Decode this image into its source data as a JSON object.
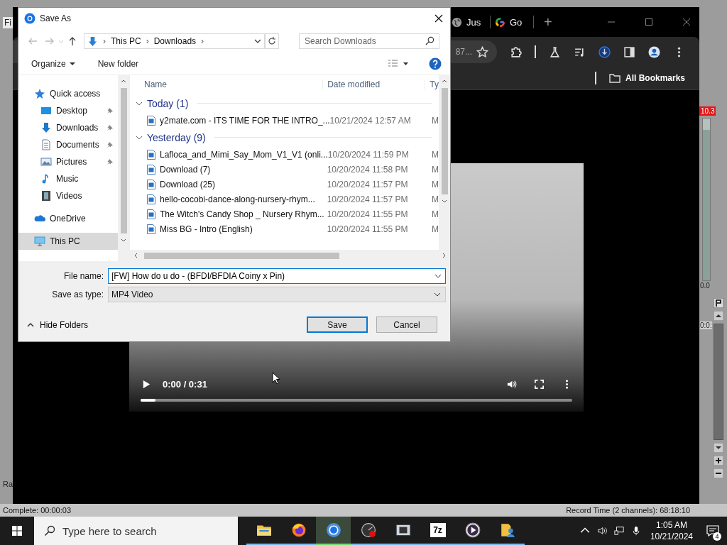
{
  "background_app": {
    "menu_fragment": "Fi",
    "side_label": "Ra",
    "meter_peak": "10.3",
    "meter_floor": "0.0",
    "time_fragment": "0:0:",
    "level": 0.93,
    "status_left": "Complete: 00:00:03",
    "status_right": "Record Time (2 channels): 68:18:10"
  },
  "browser": {
    "tabs": [
      {
        "title": "Jus",
        "kind": "globe"
      },
      {
        "title": "Go",
        "kind": "google"
      }
    ],
    "new_tab": "+",
    "address_fragment": "87...",
    "all_bookmarks": "All Bookmarks",
    "video": {
      "time": "0:00 / 0:31",
      "level": 0.034
    }
  },
  "dialog": {
    "title": "Save As",
    "breadcrumb": [
      "This PC",
      "Downloads"
    ],
    "separator": "›",
    "search_placeholder": "Search Downloads",
    "organize": "Organize",
    "new_folder": "New folder",
    "nav": [
      {
        "label": "Quick access",
        "kind": "star",
        "pinned": false,
        "selected": false
      },
      {
        "label": "Desktop",
        "kind": "desktop",
        "pinned": true,
        "selected": false
      },
      {
        "label": "Downloads",
        "kind": "download",
        "pinned": true,
        "selected": false
      },
      {
        "label": "Documents",
        "kind": "document",
        "pinned": true,
        "selected": false
      },
      {
        "label": "Pictures",
        "kind": "pictures",
        "pinned": true,
        "selected": false
      },
      {
        "label": "Music",
        "kind": "music",
        "pinned": false,
        "selected": false
      },
      {
        "label": "Videos",
        "kind": "videos",
        "pinned": false,
        "selected": false
      },
      {
        "label": "OneDrive",
        "kind": "cloud",
        "pinned": false,
        "selected": false
      },
      {
        "label": "This PC",
        "kind": "pc",
        "pinned": false,
        "selected": true
      }
    ],
    "columns": [
      "Name",
      "Date modified",
      "Ty"
    ],
    "groups": [
      {
        "label": "Today (1)",
        "expanded": true,
        "files": [
          {
            "name": "y2mate.com - ITS TIME FOR THE INTRO_...",
            "date": "10/21/2024 12:57 AM",
            "type": "M"
          }
        ]
      },
      {
        "label": "Yesterday (9)",
        "expanded": true,
        "files": [
          {
            "name": "Lafloca_and_Mimi_Say_Mom_V1_V1 (onli...",
            "date": "10/20/2024 11:59 PM",
            "type": "M"
          },
          {
            "name": "Download (7)",
            "date": "10/20/2024 11:58 PM",
            "type": "M"
          },
          {
            "name": "Download (25)",
            "date": "10/20/2024 11:57 PM",
            "type": "M"
          },
          {
            "name": "hello-cocobi-dance-along-nursery-rhym...",
            "date": "10/20/2024 11:57 PM",
            "type": "M"
          },
          {
            "name": "The Witch's Candy Shop _ Nursery Rhym...",
            "date": "10/20/2024 11:55 PM",
            "type": "M"
          },
          {
            "name": "Miss BG - Intro (English)",
            "date": "10/20/2024 11:55 PM",
            "type": "M"
          }
        ]
      }
    ],
    "file_name_label": "File name:",
    "file_name": "[FW] How do u do - (BFDI/BFDIA Coiny x Pin)",
    "type_label": "Save as type:",
    "save_type": "MP4 Video",
    "hide_folders": "Hide Folders",
    "save": "Save",
    "cancel": "Cancel"
  },
  "taskbar": {
    "search_placeholder": "Type here to search",
    "apps": [
      {
        "kind": "folder",
        "active": false
      },
      {
        "kind": "firefox",
        "active": false
      },
      {
        "kind": "chrome",
        "active": true
      },
      {
        "kind": "recorder",
        "active": false
      },
      {
        "kind": "film",
        "active": false
      },
      {
        "kind": "archive",
        "label": "7z",
        "active": false
      },
      {
        "kind": "player",
        "active": false
      },
      {
        "kind": "user-folder",
        "active": false
      }
    ],
    "time": "1:05 AM",
    "date": "10/21/2024",
    "notifications": "4"
  }
}
